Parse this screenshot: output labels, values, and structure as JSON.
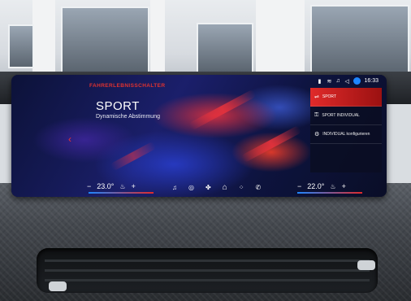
{
  "display": {
    "brand_label": "FAHRERLEBNISSCHALTER",
    "mode_title": "SPORT",
    "mode_subtitle": "Dynamische Abstimmung",
    "status": {
      "time": "16:33"
    },
    "modes": [
      {
        "label": "SPORT",
        "active": true,
        "icon": "steering-icon"
      },
      {
        "label": "SPORT INDIVIDUAL",
        "active": false,
        "icon": "key-icon"
      },
      {
        "label": "INDIVIDUAL konfigurieren",
        "active": false,
        "icon": "gear-icon"
      }
    ],
    "climate_left": {
      "temp": "23.0°"
    },
    "climate_right": {
      "temp": "22.0°"
    },
    "colors": {
      "accent": "#e02a2a",
      "blue": "#1e86ff"
    },
    "nav_icons": [
      "music-icon",
      "circle-icon",
      "fan-icon",
      "home-icon",
      "apps-icon",
      "phone-icon"
    ]
  }
}
